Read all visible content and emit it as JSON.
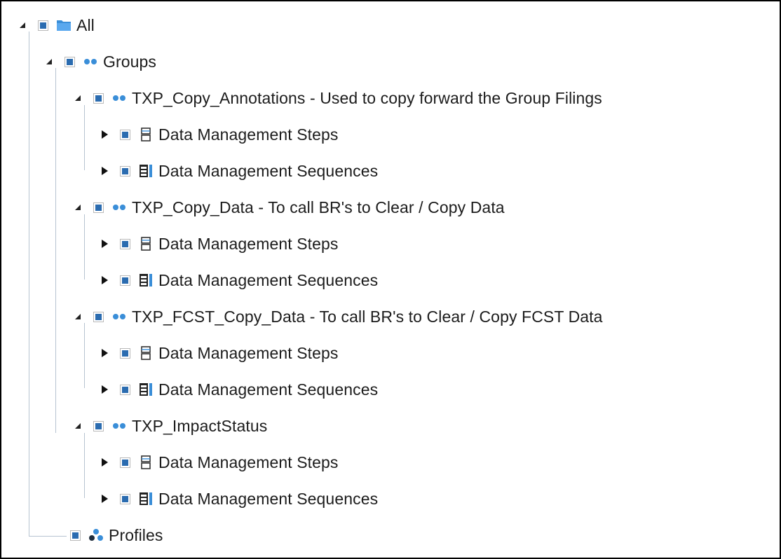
{
  "colors": {
    "checkbox_fill": "#2b6cb0",
    "icon_blue": "#3a8ed8",
    "tree_line": "#b6c3d1",
    "text": "#1c1c1c"
  },
  "tree": {
    "root": {
      "label": "All",
      "icon": "folder-icon",
      "expanded": true
    },
    "groups": {
      "label": "Groups",
      "icon": "group-icon",
      "expanded": true
    },
    "items": [
      {
        "label": "TXP_Copy_Annotations - Used to copy forward the Group Filings",
        "icon": "group-icon",
        "expanded": true,
        "steps_label": "Data Management Steps",
        "sequences_label": "Data Management Sequences"
      },
      {
        "label": "TXP_Copy_Data - To call BR's to Clear / Copy Data",
        "icon": "group-icon",
        "expanded": true,
        "steps_label": "Data Management Steps",
        "sequences_label": "Data Management Sequences"
      },
      {
        "label": "TXP_FCST_Copy_Data - To call BR's to Clear / Copy FCST Data",
        "icon": "group-icon",
        "expanded": true,
        "steps_label": "Data Management Steps",
        "sequences_label": "Data Management Sequences"
      },
      {
        "label": "TXP_ImpactStatus",
        "icon": "group-icon",
        "expanded": true,
        "steps_label": "Data Management Steps",
        "sequences_label": "Data Management Sequences"
      }
    ],
    "profiles": {
      "label": "Profiles",
      "icon": "profiles-icon"
    }
  }
}
